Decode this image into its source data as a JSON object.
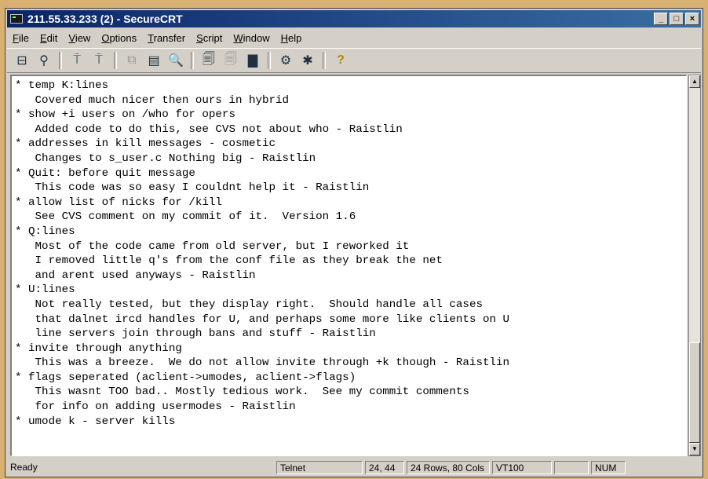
{
  "window": {
    "title": "211.55.33.233 (2) - SecureCRT",
    "minimize_label": "_",
    "maximize_label": "□",
    "close_label": "×"
  },
  "menu": [
    {
      "first": "F",
      "rest": "ile"
    },
    {
      "first": "E",
      "rest": "dit"
    },
    {
      "first": "V",
      "rest": "iew"
    },
    {
      "first": "O",
      "rest": "ptions"
    },
    {
      "first": "T",
      "rest": "ransfer"
    },
    {
      "first": "S",
      "rest": "cript"
    },
    {
      "first": "W",
      "rest": "indow"
    },
    {
      "first": "H",
      "rest": "elp"
    }
  ],
  "toolbar": {
    "icons": [
      "connect-icon",
      "quick-connect-icon",
      "disconnect-icon",
      "reconnect-icon",
      "copy-icon",
      "paste-icon",
      "find-icon",
      "print-icon",
      "print-selection-icon",
      "printer-icon",
      "session-options-icon",
      "keymap-icon",
      "help-icon"
    ],
    "glyphs": {
      "connect": "⊟",
      "quick_connect": "⚲",
      "disconnect": "⍑",
      "reconnect": "⍑",
      "copy": "⧉",
      "paste": "▤",
      "find": "🔍",
      "print": "🗐",
      "print_selection": "🗐",
      "printer": "▇",
      "session_options": "⚙",
      "keymap": "✱",
      "help": "?"
    }
  },
  "terminal": {
    "lines": [
      "* temp K:lines",
      "   Covered much nicer then ours in hybrid",
      "* show +i users on /who for opers",
      "   Added code to do this, see CVS not about who - Raistlin",
      "* addresses in kill messages - cosmetic",
      "   Changes to s_user.c Nothing big - Raistlin",
      "* Quit: before quit message",
      "   This code was so easy I couldnt help it - Raistlin",
      "* allow list of nicks for /kill",
      "   See CVS comment on my commit of it.  Version 1.6",
      "* Q:lines",
      "   Most of the code came from old server, but I reworked it",
      "   I removed little q's from the conf file as they break the net",
      "   and arent used anyways - Raistlin",
      "* U:lines",
      "   Not really tested, but they display right.  Should handle all cases",
      "   that dalnet ircd handles for U, and perhaps some more like clients on U",
      "   line servers join through bans and stuff - Raistlin",
      "* invite through anything",
      "   This was a breeze.  We do not allow invite through +k though - Raistlin",
      "* flags seperated (aclient->umodes, aclient->flags)",
      "   This wasnt TOO bad.. Mostly tedious work.  See my commit comments",
      "   for info on adding usermodes - Raistlin",
      "* umode k - server kills"
    ]
  },
  "status": {
    "ready": "Ready",
    "protocol": "Telnet",
    "cursor": "24, 44",
    "size": "24 Rows, 80 Cols",
    "emulation": "VT100",
    "blank": "",
    "num": "NUM"
  }
}
